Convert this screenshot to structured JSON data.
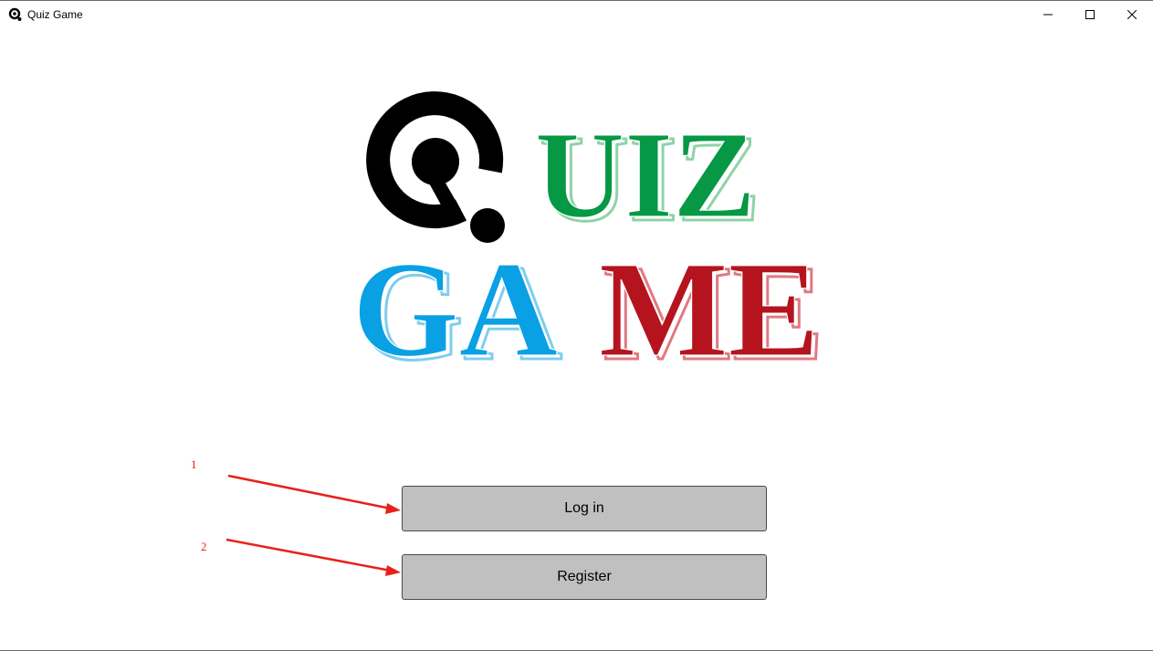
{
  "window": {
    "title": "Quiz Game",
    "icon": "quiz-q-icon",
    "controls": [
      "minimize-icon",
      "maximize-icon",
      "close-icon"
    ]
  },
  "logo": {
    "word1": "UIZ",
    "word2_parts": [
      "GA",
      "ME"
    ],
    "colors": {
      "q_mark": "#000000",
      "uiz": "#069845",
      "ga": "#0aa0e4",
      "me": "#b5141f"
    }
  },
  "buttons": {
    "login_label": "Log in",
    "register_label": "Register"
  },
  "annotations": {
    "marker_1": "1",
    "marker_2": "2",
    "color": "#e8201a"
  }
}
